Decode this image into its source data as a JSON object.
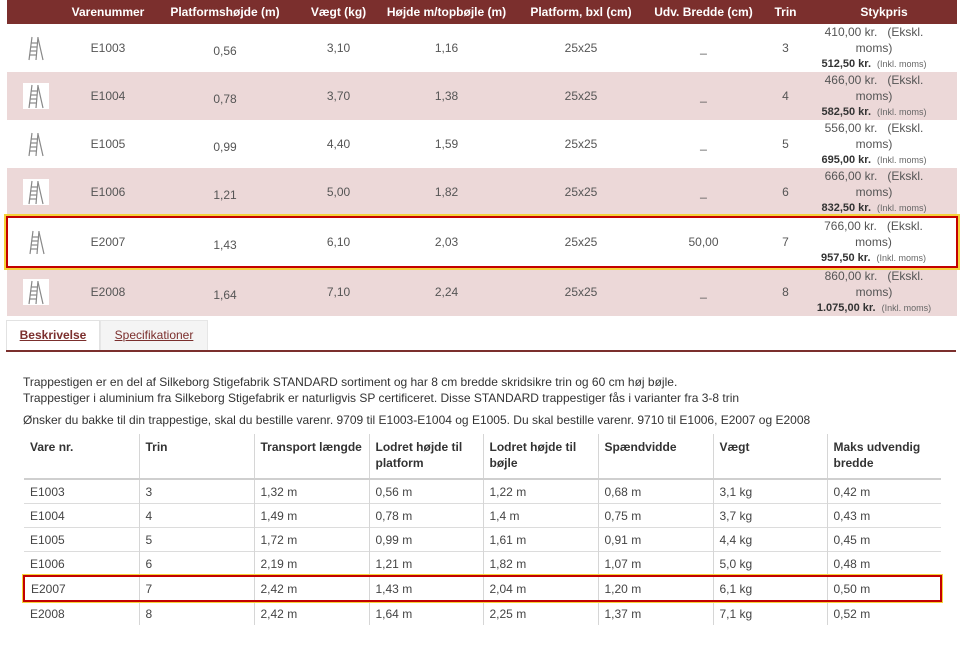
{
  "product_table": {
    "headers": [
      "",
      "Varenummer",
      "Platformshøjde (m)",
      "Vægt (kg)",
      "Højde m/topbøjle (m)",
      "Platform, bxl (cm)",
      "Udv. Bredde (cm)",
      "Trin",
      "Stykpris"
    ],
    "rows": [
      {
        "varenr": "E1003",
        "platform_h": "0,56",
        "weight": "3,10",
        "height": "1,16",
        "platform": "25x25",
        "width": "_",
        "steps": "3",
        "price_ex": "410,00 kr.",
        "ex_label": "(Ekskl. moms)",
        "price_inc": "512,50 kr.",
        "inc_label": "(Inkl. moms)",
        "thumb_icon": "ladder-icon"
      },
      {
        "varenr": "E1004",
        "platform_h": "0,78",
        "weight": "3,70",
        "height": "1,38",
        "platform": "25x25",
        "width": "_",
        "steps": "4",
        "price_ex": "466,00 kr.",
        "ex_label": "(Ekskl. moms)",
        "price_inc": "582,50 kr.",
        "inc_label": "(Inkl. moms)",
        "thumb_icon": "ladder-icon"
      },
      {
        "varenr": "E1005",
        "platform_h": "0,99",
        "weight": "4,40",
        "height": "1,59",
        "platform": "25x25",
        "width": "_",
        "steps": "5",
        "price_ex": "556,00 kr.",
        "ex_label": "(Ekskl. moms)",
        "price_inc": "695,00 kr.",
        "inc_label": "(Inkl. moms)",
        "thumb_icon": "ladder-icon"
      },
      {
        "varenr": "E1006",
        "platform_h": "1,21",
        "weight": "5,00",
        "height": "1,82",
        "platform": "25x25",
        "width": "_",
        "steps": "6",
        "price_ex": "666,00 kr.",
        "ex_label": "(Ekskl. moms)",
        "price_inc": "832,50 kr.",
        "inc_label": "(Inkl. moms)",
        "thumb_icon": "ladder-icon"
      },
      {
        "varenr": "E2007",
        "platform_h": "1,43",
        "weight": "6,10",
        "height": "2,03",
        "platform": "25x25",
        "width": "50,00",
        "steps": "7",
        "price_ex": "766,00 kr.",
        "ex_label": "(Ekskl. moms)",
        "price_inc": "957,50 kr.",
        "inc_label": "(Inkl. moms)",
        "thumb_icon": "ladder-icon",
        "highlighted": true
      },
      {
        "varenr": "E2008",
        "platform_h": "1,64",
        "weight": "7,10",
        "height": "2,24",
        "platform": "25x25",
        "width": "_",
        "steps": "8",
        "price_ex": "860,00 kr.",
        "ex_label": "(Ekskl. moms)",
        "price_inc": "1.075,00 kr.",
        "inc_label": "(Inkl. moms)",
        "thumb_icon": "ladder-icon"
      }
    ]
  },
  "tabs": {
    "active": "Beskrivelse",
    "inactive": "Specifikationer"
  },
  "description": {
    "line1": "Trappestigen er en del af Silkeborg Stigefabrik STANDARD sortiment og har 8 cm bredde skridsikre trin og 60 cm høj bøjle.",
    "line2": "Trappestiger i aluminium fra Silkeborg Stigefabrik er naturligvis SP certificeret. Disse STANDARD trappestiger fås i varianter fra 3-8 trin",
    "line3": "Ønsker du bakke til din trappestige, skal du bestille varenr. 9709 til E1003-E1004 og E1005. Du skal bestille varenr. 9710 til E1006, E2007 og E2008"
  },
  "spec_table": {
    "headers": [
      "Vare nr.",
      "Trin",
      "Transport længde",
      "Lodret højde til platform",
      "Lodret højde til bøjle",
      "Spændvidde",
      "Vægt",
      "Maks udvendig bredde"
    ],
    "rows": [
      [
        "E1003",
        "3",
        "1,32 m",
        "0,56 m",
        "1,22 m",
        "0,68 m",
        "3,1 kg",
        "0,42 m"
      ],
      [
        "E1004",
        "4",
        "1,49 m",
        "0,78 m",
        "1,4 m",
        "0,75 m",
        "3,7 kg",
        "0,43 m"
      ],
      [
        "E1005",
        "5",
        "1,72 m",
        "0,99 m",
        "1,61 m",
        "0,91 m",
        "4,4 kg",
        "0,45 m"
      ],
      [
        "E1006",
        "6",
        "2,19 m",
        "1,21 m",
        "1,82 m",
        "1,07 m",
        "5,0 kg",
        "0,48 m"
      ],
      [
        "E2007",
        "7",
        "2,42 m",
        "1,43 m",
        "2,04 m",
        "1,20 m",
        "6,1 kg",
        "0,50 m"
      ],
      [
        "E2008",
        "8",
        "2,42 m",
        "1,64 m",
        "2,25 m",
        "1,37 m",
        "7,1 kg",
        "0,52 m"
      ]
    ],
    "highlighted_row": 4
  },
  "colors": {
    "header_bg": "#7b2f2d",
    "row_alt": "#ecd8d8",
    "highlight_border": "#c30000",
    "highlight_glow": "#f5d23a"
  }
}
